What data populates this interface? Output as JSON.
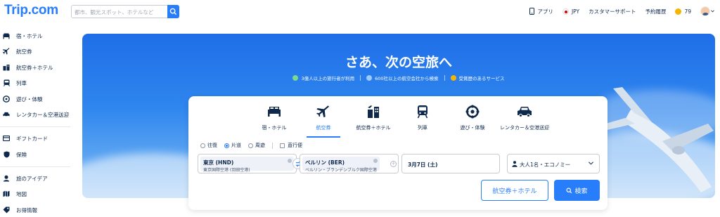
{
  "brand": {
    "logo": "Trip.com",
    "accent": "#287dfa"
  },
  "search": {
    "placeholder": "都市、観光スポット、ホテルなど"
  },
  "top_nav": {
    "app": "アプリ",
    "currency": "JPY",
    "support": "カスタマーサポート",
    "bookings": "予約履歴",
    "points": "79"
  },
  "sidebar": {
    "items": [
      {
        "label": "宿・ホテル",
        "icon": "bed-icon"
      },
      {
        "label": "航空券",
        "icon": "airplane-icon"
      },
      {
        "label": "航空券＋ホテル",
        "icon": "flight-hotel-icon"
      },
      {
        "label": "列車",
        "icon": "train-icon"
      },
      {
        "label": "遊び・体験",
        "icon": "attraction-icon"
      },
      {
        "label": "レンタカー＆空港送迎",
        "icon": "car-icon"
      },
      {
        "label": "ギフトカード",
        "icon": "gift-card-icon"
      },
      {
        "label": "保険",
        "icon": "shield-icon"
      },
      {
        "label": "旅のアイデア",
        "icon": "idea-icon"
      },
      {
        "label": "地図",
        "icon": "map-icon"
      },
      {
        "label": "お得情報",
        "icon": "deals-icon"
      }
    ]
  },
  "hero": {
    "title": "さあ、次の空旅へ",
    "features": [
      "3億人以上の旅行者が利用",
      "600社以上の航空会社から検索",
      "受賞歴のあるサービス"
    ]
  },
  "booking": {
    "tabs": [
      {
        "label": "宿・ホテル",
        "icon": "bed-icon"
      },
      {
        "label": "航空券",
        "icon": "airplane-icon",
        "active": true
      },
      {
        "label": "航空券＋ホテル",
        "icon": "flight-hotel-icon"
      },
      {
        "label": "列車",
        "icon": "train-icon"
      },
      {
        "label": "遊び・体験",
        "icon": "attraction-icon"
      },
      {
        "label": "レンタカー＆空港送迎",
        "icon": "car-icon"
      }
    ],
    "trip_types": [
      "往復",
      "片道",
      "周遊"
    ],
    "selected_trip_type": "片道",
    "direct_only": "直行便",
    "origin": {
      "code": "東京 (HND)",
      "airport": "東京国際空港 (羽田空港)"
    },
    "destination": {
      "code": "ベルリン (BER)",
      "airport": "ベルリン・ブランデンブルク国際空港"
    },
    "date": "3月7日 (土)",
    "passengers": "大人1名・エコノミー",
    "combo_button": "航空券＋ホテル",
    "search_button": "検索"
  }
}
